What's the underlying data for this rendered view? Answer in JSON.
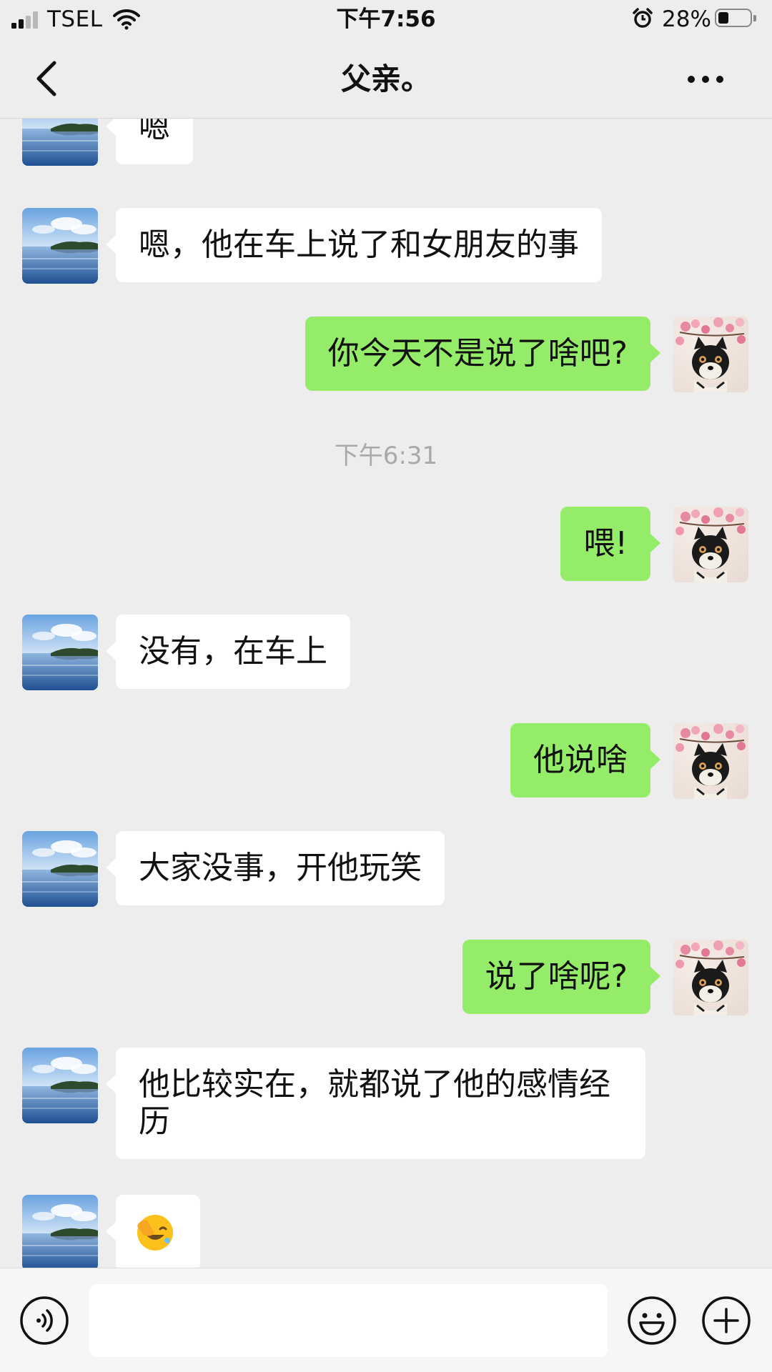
{
  "status_bar": {
    "carrier": "TSEL",
    "time": "下午7:56",
    "battery_percent": "28%",
    "battery_level": 0.28,
    "signal_bars": 2,
    "icons": [
      "signal-icon",
      "wifi-icon",
      "alarm-icon",
      "battery-icon"
    ]
  },
  "nav": {
    "title": "父亲。",
    "icons": [
      "back-chevron-icon",
      "more-icon"
    ]
  },
  "messages": [
    {
      "side": "in",
      "text": "嗯",
      "avatar": "lake-avatar"
    },
    {
      "side": "in",
      "text": "嗯，他在车上说了和女朋友的事",
      "avatar": "lake-avatar"
    },
    {
      "side": "out",
      "text": "你今天不是说了啥吧?",
      "avatar": "shiba-avatar"
    },
    {
      "side": "out",
      "text": "喂!",
      "avatar": "shiba-avatar"
    },
    {
      "side": "in",
      "text": "没有，在车上",
      "avatar": "lake-avatar"
    },
    {
      "side": "out",
      "text": "他说啥",
      "avatar": "shiba-avatar"
    },
    {
      "side": "in",
      "text": "大家没事，开他玩笑",
      "avatar": "lake-avatar"
    },
    {
      "side": "out",
      "text": "说了啥呢?",
      "avatar": "shiba-avatar"
    },
    {
      "side": "in",
      "text": "他比较实在，就都说了他的感情经历",
      "avatar": "lake-avatar"
    },
    {
      "side": "in",
      "text": "",
      "emoji": "facepalm-emoji",
      "avatar": "lake-avatar"
    }
  ],
  "time_separator": "下午6:31",
  "input_bar": {
    "placeholder": "",
    "icons": [
      "voice-icon",
      "emoji-icon",
      "plus-icon"
    ]
  },
  "colors": {
    "background": "#ededed",
    "outgoing_bubble": "#95ec69",
    "incoming_bubble": "#ffffff",
    "time_separator": "#a9a9a9"
  }
}
